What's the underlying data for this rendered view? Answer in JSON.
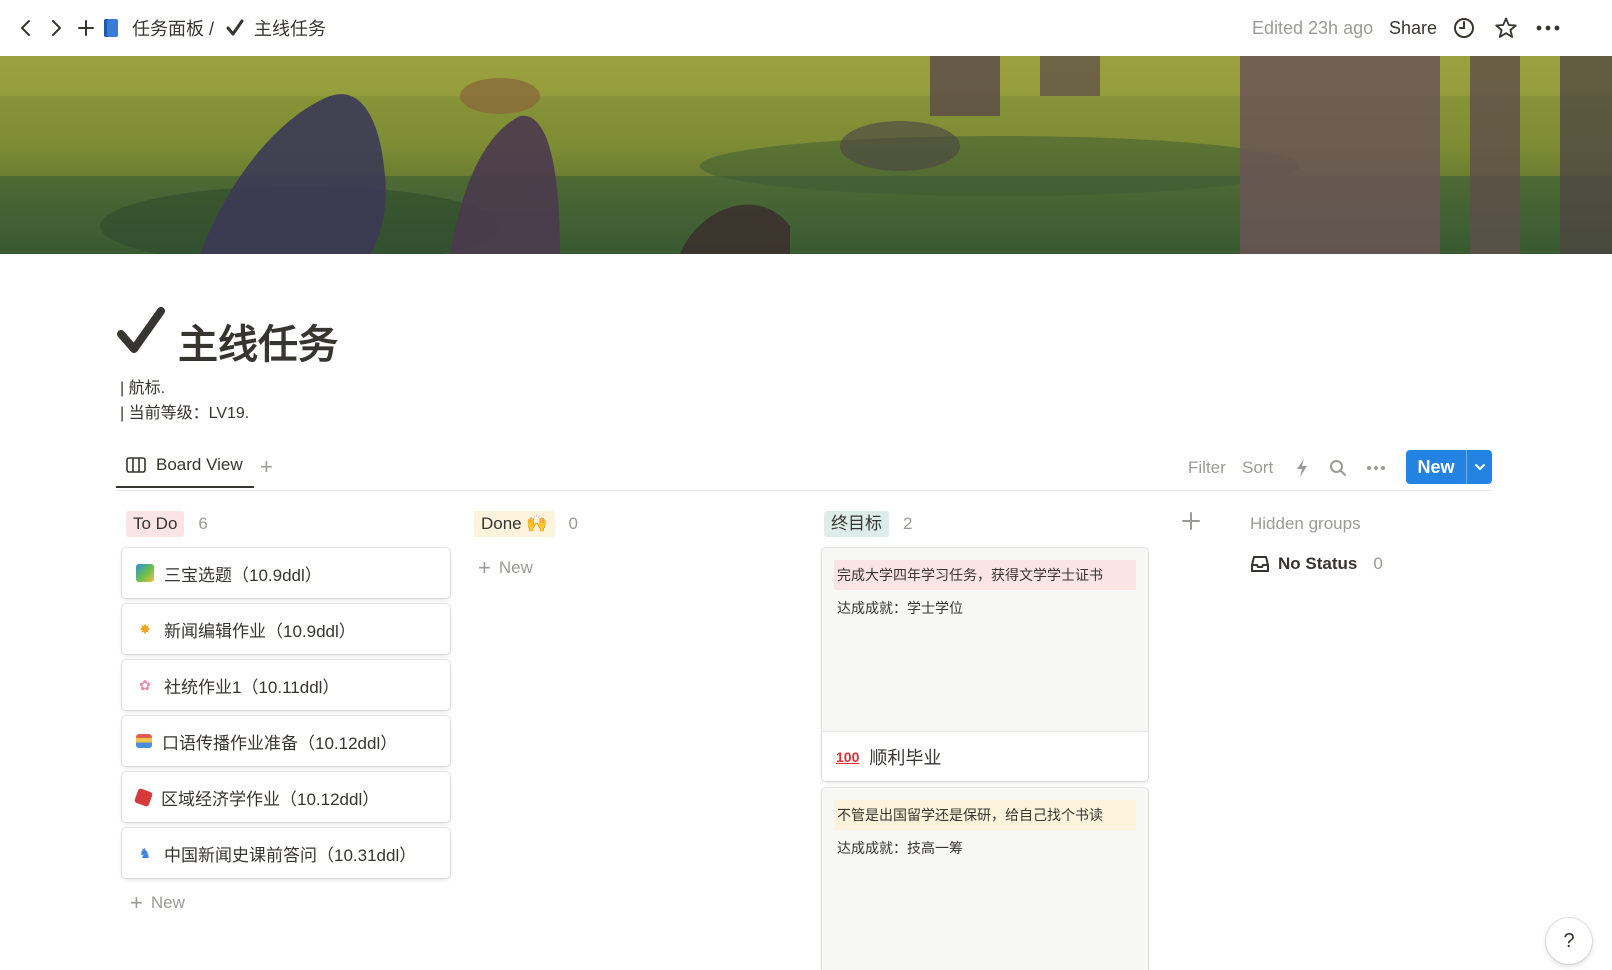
{
  "breadcrumb": {
    "parent": "任务面板 /",
    "current": "主线任务"
  },
  "topbar": {
    "edited": "Edited 23h ago",
    "share": "Share"
  },
  "page": {
    "title": "主线任务",
    "desc_line1": "| 航标.",
    "desc_line2": "| 当前等级：LV19."
  },
  "views": {
    "active": "Board View"
  },
  "toolbar": {
    "filter": "Filter",
    "sort": "Sort",
    "new": "New"
  },
  "board": {
    "todo": {
      "label": "To Do",
      "count": "6",
      "color": "#fbe4e4",
      "cards": [
        {
          "title": "三宝选题（10.9ddl）",
          "icon": "picture-icon"
        },
        {
          "title": "新闻编辑作业（10.9ddl）",
          "icon": "star-icon"
        },
        {
          "title": "社统作业1（10.11ddl）",
          "icon": "blossom-icon"
        },
        {
          "title": "口语传播作业准备（10.12ddl）",
          "icon": "books-icon"
        },
        {
          "title": "区域经济学作业（10.12ddl）",
          "icon": "dice-icon"
        },
        {
          "title": "中国新闻史课前答问（10.31ddl）",
          "icon": "carousel-icon"
        }
      ],
      "new_label": "New"
    },
    "done": {
      "label": "Done 🙌",
      "count": "0",
      "color": "#fbf3db",
      "new_label": "New"
    },
    "goal": {
      "label": "终目标",
      "count": "2",
      "color": "#ddedea",
      "cards": [
        {
          "highlight": "完成大学四年学习任务，获得文学学士证书",
          "highlight_color": "#fbe4e4",
          "achievement": "达成成就：学士学位",
          "title": "顺利毕业",
          "icon": "hundred-points-icon"
        },
        {
          "highlight": "不管是出国留学还是保研，给自己找个书读",
          "highlight_color": "#fbf3db",
          "achievement": "达成成就：技高一筹"
        }
      ]
    },
    "hidden_groups": {
      "label": "Hidden groups",
      "no_status": "No Status",
      "no_status_count": "0"
    }
  },
  "help": "?"
}
